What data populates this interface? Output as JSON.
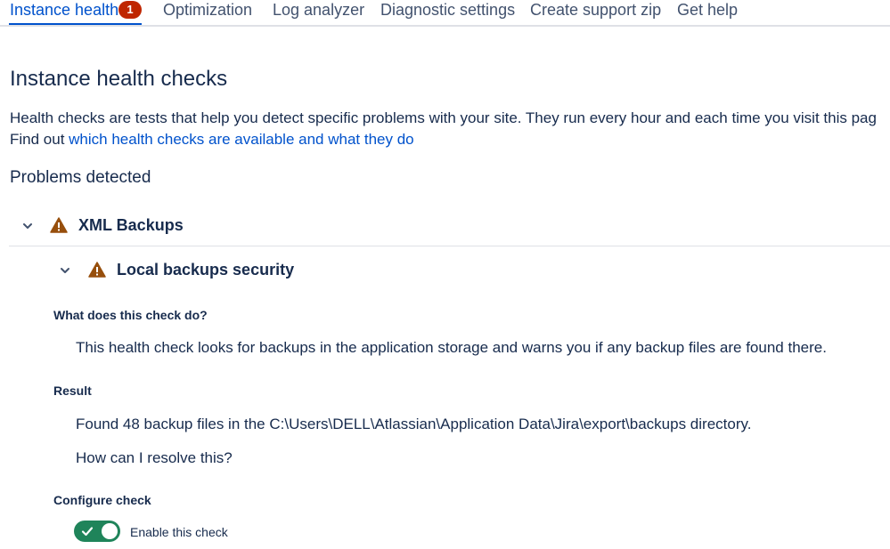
{
  "tabs": [
    {
      "label": "Instance health",
      "badge": "1"
    },
    {
      "label": "Optimization"
    },
    {
      "label": "Log analyzer"
    },
    {
      "label": "Diagnostic settings"
    },
    {
      "label": "Create support zip"
    },
    {
      "label": "Get help"
    }
  ],
  "page": {
    "title": "Instance health checks",
    "intro": "Health checks are tests that help you detect specific problems with your site. They run every hour and each time you visit this pag",
    "find_out_prefix": "Find out ",
    "find_out_link": "which health checks are available and what they do",
    "problems_heading": "Problems detected"
  },
  "groups": [
    {
      "title": "XML Backups",
      "checks": [
        {
          "title": "Local backups security",
          "what_label": "What does this check do?",
          "what_text": "This health check looks for backups in the application storage and warns you if any backup files are found there.",
          "result_label": "Result",
          "result_text": "Found 48 backup files in the C:\\Users\\DELL\\Atlassian\\Application Data\\Jira\\export\\backups directory.",
          "resolve_link": "How can I resolve this?",
          "configure_label": "Configure check",
          "toggle_label": "Enable this check",
          "enabled": true
        }
      ]
    }
  ],
  "colors": {
    "accent": "#0052cc",
    "badge": "#bf2600",
    "warning": "#974f0c",
    "toggle_on": "#1f845a",
    "text": "#172b4d"
  },
  "icons": {
    "chevron": "chevron-down-icon",
    "warning": "warning-icon",
    "check": "check-icon"
  }
}
